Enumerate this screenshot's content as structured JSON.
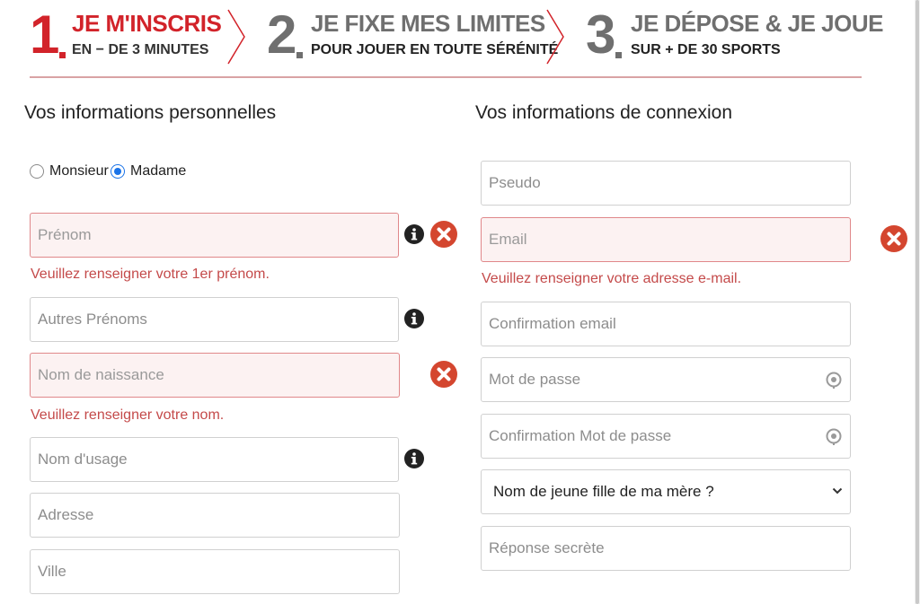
{
  "steps": [
    {
      "number": "1",
      "title": "JE M'INSCRIS",
      "subtitle": "EN − DE 3 MINUTES"
    },
    {
      "number": "2",
      "title": "JE FIXE MES LIMITES",
      "subtitle": "POUR JOUER EN TOUTE SÉRÉNITÉ"
    },
    {
      "number": "3",
      "title": "JE DÉPOSE & JE JOUE",
      "subtitle": "SUR + DE 30 SPORTS"
    }
  ],
  "colors": {
    "accent": "#d2232a",
    "error": "#c44a4a",
    "error_icon": "#d4462f",
    "radio_checked": "#1a73e8"
  },
  "personal": {
    "title": "Vos informations personnelles",
    "civility": {
      "monsieur": "Monsieur",
      "madame": "Madame",
      "selected": "Madame"
    },
    "prenom": {
      "placeholder": "Prénom",
      "error": "Veuillez renseigner votre 1er prénom."
    },
    "autres_prenoms": {
      "placeholder": "Autres Prénoms"
    },
    "nom_naissance": {
      "placeholder": "Nom de naissance",
      "error": "Veuillez renseigner votre nom."
    },
    "nom_usage": {
      "placeholder": "Nom d'usage"
    },
    "adresse": {
      "placeholder": "Adresse"
    },
    "ville": {
      "placeholder": "Ville"
    }
  },
  "connexion": {
    "title": "Vos informations de connexion",
    "pseudo": {
      "placeholder": "Pseudo"
    },
    "email": {
      "placeholder": "Email",
      "error": "Veuillez renseigner votre adresse e-mail."
    },
    "confirmation_email": {
      "placeholder": "Confirmation email"
    },
    "mot_de_passe": {
      "placeholder": "Mot de passe"
    },
    "confirmation_mdp": {
      "placeholder": "Confirmation Mot de passe"
    },
    "question_secrete": {
      "selected": "Nom de jeune fille de ma mère ?"
    },
    "reponse_secrete": {
      "placeholder": "Réponse secrète"
    }
  },
  "icons": {
    "info": "info-icon",
    "error": "error-x-icon",
    "password_toggle": "eye-icon",
    "dropdown": "chevron-down-icon"
  }
}
